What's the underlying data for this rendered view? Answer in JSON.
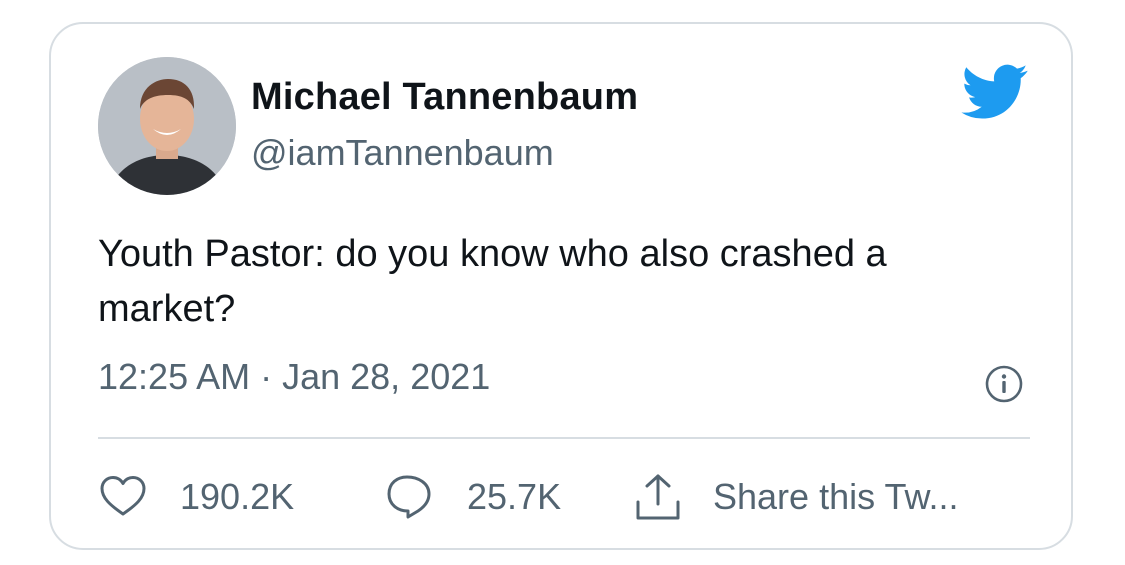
{
  "author": {
    "display_name": "Michael Tannenbaum",
    "handle": "@iamTannenbaum"
  },
  "tweet": {
    "text": "Youth Pastor: do you know who also crashed a market?",
    "timestamp": "12:25 AM · Jan 28, 2021"
  },
  "actions": {
    "likes": "190.2K",
    "replies": "25.7K",
    "share_label": "Share this Tw..."
  },
  "icons": {
    "logo": "twitter-bird-icon",
    "info": "info-icon",
    "like": "heart-icon",
    "reply": "speech-bubble-icon",
    "share": "share-upload-icon"
  },
  "colors": {
    "brand": "#1d9bf0",
    "text_primary": "#0f1419",
    "text_secondary": "#536471",
    "border": "#d7dde2"
  }
}
